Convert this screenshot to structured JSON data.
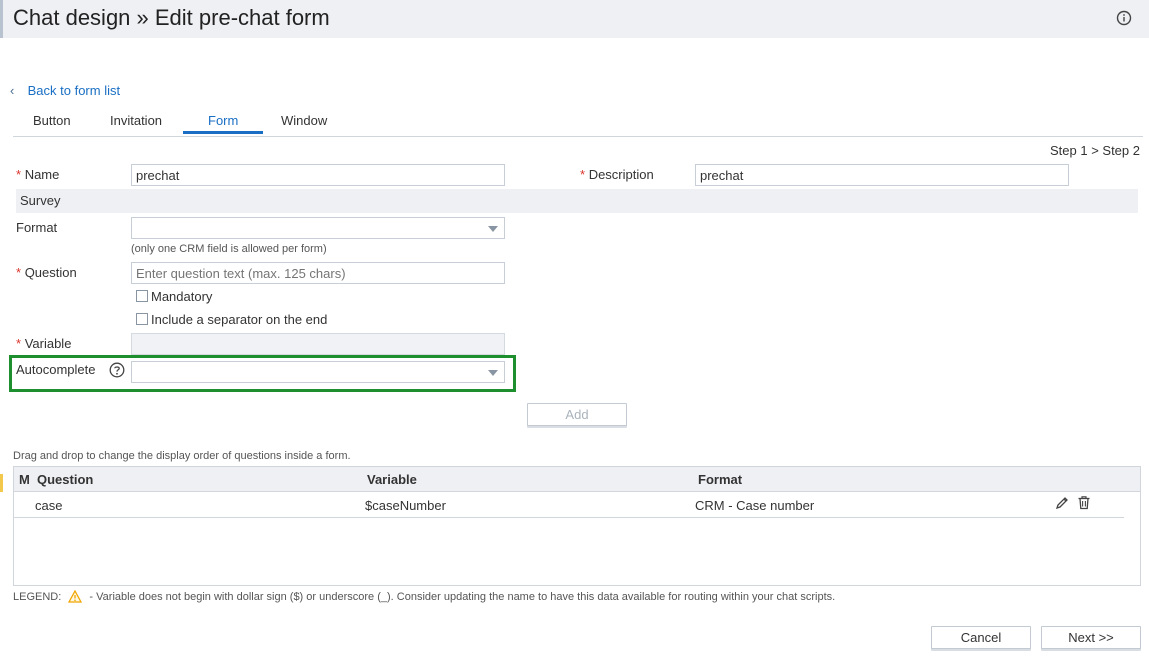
{
  "header": {
    "title": "Chat design » Edit pre-chat form"
  },
  "nav": {
    "back_label": "Back to form list"
  },
  "tabs": [
    {
      "label": "Button"
    },
    {
      "label": "Invitation"
    },
    {
      "label": "Form",
      "active": true
    },
    {
      "label": "Window"
    }
  ],
  "steps": "Step 1 > Step 2",
  "form": {
    "required_mark": "*",
    "name_label": "Name",
    "name_value": "prechat",
    "description_label": "Description",
    "description_value": "prechat",
    "survey_label": "Survey",
    "format_label": "Format",
    "format_value": "",
    "format_hint": "(only one CRM field is allowed per form)",
    "question_label": "Question",
    "question_placeholder": "Enter question text (max. 125 chars)",
    "mandatory_label": "Mandatory",
    "mandatory_checked": false,
    "separator_label": "Include a separator on the end",
    "separator_checked": false,
    "variable_label": "Variable",
    "variable_value": "",
    "autocomplete_label": "Autocomplete",
    "autocomplete_value": "",
    "add_label": "Add"
  },
  "table": {
    "drag_hint": "Drag and drop to change the display order of questions inside a form.",
    "columns": {
      "m": "M",
      "question": "Question",
      "variable": "Variable",
      "format": "Format"
    },
    "rows": [
      {
        "question": "case",
        "variable": "$caseNumber",
        "format": "CRM - Case number"
      }
    ]
  },
  "legend": {
    "prefix": "LEGEND:",
    "text": "- Variable does not begin with dollar sign ($) or underscore (_). Consider updating the name to have this data available for routing within your chat scripts."
  },
  "footer": {
    "cancel_label": "Cancel",
    "next_label": "Next >>"
  },
  "icons": [
    "info-icon",
    "chevron-left-icon",
    "help-icon",
    "chevron-down-icon",
    "pencil-icon",
    "trash-icon",
    "warning-icon"
  ],
  "colors": {
    "accent": "#1a6fc4",
    "highlight": "#1e8f2e",
    "required": "#d9342b",
    "warning": "#f0a500"
  }
}
